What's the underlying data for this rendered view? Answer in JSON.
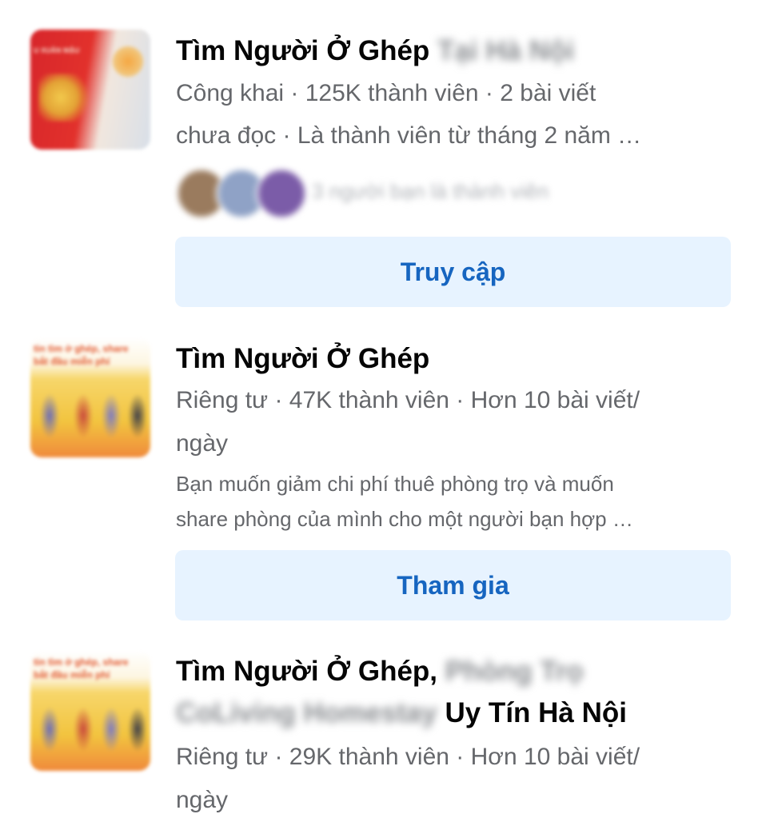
{
  "groups": [
    {
      "thumbnail": "group-cover-red",
      "thumb_text": "U XUÂN  MẬU",
      "name_visible": "Tìm Người Ở Ghép",
      "name_hidden": "Tại Hà Nội",
      "meta_line1": "Công khai · 125K thành viên · 2 bài viết",
      "meta_line2": "chưa đọc · Là thành viên từ tháng 2 năm …",
      "friends_text": "3 người bạn là thành viên",
      "friend_avatar_colors": [
        "#9a7b5e",
        "#8fa2c6",
        "#7b5ca8"
      ],
      "button_label": "Truy cập"
    },
    {
      "thumbnail": "group-cover-yellow",
      "thumb_text": "tin tìm ở ghép, share\nbắt đầu miễn phí",
      "name_visible": "Tìm Người Ở Ghép",
      "meta_line1": "Riêng tư · 47K thành viên · Hơn 10 bài viết/",
      "meta_line2": "ngày",
      "desc_line1": "Bạn muốn giảm chi phí thuê phòng trọ và muốn",
      "desc_line2": "share phòng của mình cho một người bạn hợp …",
      "button_label": "Tham gia"
    },
    {
      "thumbnail": "group-cover-yellow",
      "thumb_text": "tin tìm ở ghép, share\nbắt đầu miễn phí",
      "name_visible": "Tìm Người Ở Ghép,",
      "name_hidden_1": "Phòng Trọ",
      "name_hidden_2": "CoLiving Homestay",
      "name_visible_2": "Uy Tín Hà Nội",
      "meta_line1": "Riêng tư · 29K thành viên · Hơn 10 bài viết/",
      "meta_line2": "ngày"
    }
  ],
  "colors": {
    "button_bg": "#e7f3ff",
    "button_text": "#1665c0",
    "secondary_text": "#65676b",
    "primary_text": "#050505"
  }
}
